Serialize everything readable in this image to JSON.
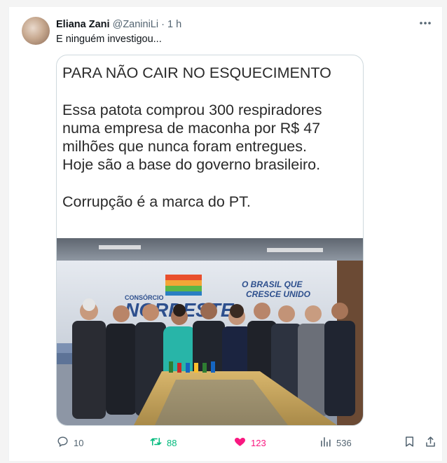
{
  "tweet": {
    "author_name": "Eliana Zani",
    "author_handle": "@ZaniniLi",
    "separator": "·",
    "time": "1 h",
    "text": "E ninguém investigou..."
  },
  "image": {
    "lines": [
      "PARA NÃO CAIR NO ESQUECIMENTO",
      "Essa patota comprou 300 respiradores",
      "numa empresa de maconha por R$ 47",
      "milhões que nunca foram entregues.",
      "Hoje são a base do governo brasileiro.",
      "Corrupção é a marca do PT."
    ],
    "banner_logo_small": "CONSÓRCIO",
    "banner_logo_big": "NORDESTE",
    "banner_slogan_1": "O BRASIL QUE",
    "banner_slogan_2": "CRESCE UNIDO"
  },
  "actions": {
    "replies": "10",
    "retweets": "88",
    "likes": "123",
    "views": "536"
  },
  "colors": {
    "retweet": "#00ba7c",
    "like": "#f91880",
    "muted": "#536471"
  },
  "icons": [
    "reply-icon",
    "retweet-icon",
    "heart-icon",
    "views-icon",
    "bookmark-icon",
    "share-icon",
    "more-icon"
  ]
}
